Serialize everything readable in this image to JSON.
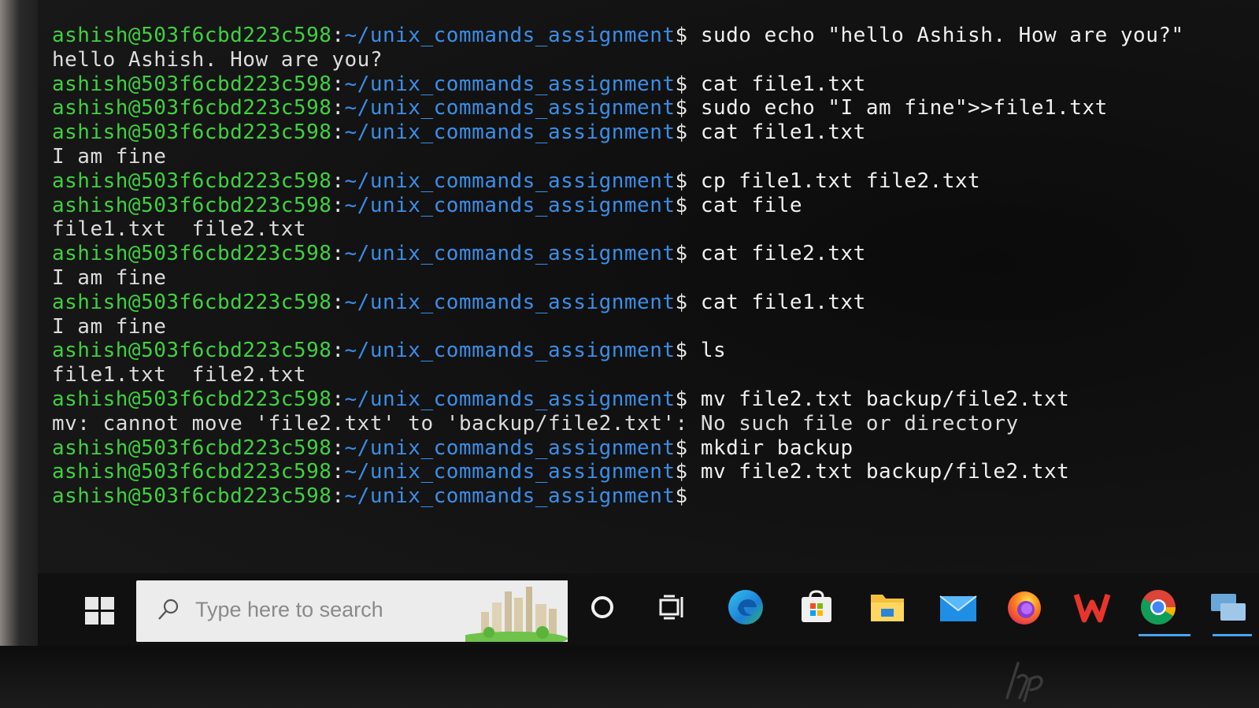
{
  "terminal": {
    "prompt": {
      "user_host": "ashish@503f6cbd223c598",
      "path": "~/unix_commands_assignment",
      "symbol": "$"
    },
    "lines": [
      {
        "type": "prompt",
        "command": " sudo echo \"hello Ashish. How are you?\""
      },
      {
        "type": "output",
        "text": "hello Ashish. How are you?"
      },
      {
        "type": "prompt",
        "command": " cat file1.txt"
      },
      {
        "type": "prompt",
        "command": " sudo echo \"I am fine\">>file1.txt"
      },
      {
        "type": "prompt",
        "command": " cat file1.txt"
      },
      {
        "type": "output",
        "text": "I am fine"
      },
      {
        "type": "prompt",
        "command": " cp file1.txt file2.txt"
      },
      {
        "type": "prompt",
        "command": " cat file"
      },
      {
        "type": "output",
        "text": "file1.txt  file2.txt"
      },
      {
        "type": "prompt",
        "command": " cat file2.txt"
      },
      {
        "type": "output",
        "text": "I am fine"
      },
      {
        "type": "prompt",
        "command": " cat file1.txt"
      },
      {
        "type": "output",
        "text": "I am fine"
      },
      {
        "type": "prompt",
        "command": " ls"
      },
      {
        "type": "output",
        "text": "file1.txt  file2.txt"
      },
      {
        "type": "prompt",
        "command": " mv file2.txt backup/file2.txt"
      },
      {
        "type": "output",
        "text": "mv: cannot move 'file2.txt' to 'backup/file2.txt': No such file or directory"
      },
      {
        "type": "prompt",
        "command": " mkdir backup"
      },
      {
        "type": "prompt",
        "command": " mv file2.txt backup/file2.txt"
      },
      {
        "type": "prompt",
        "command": ""
      }
    ]
  },
  "taskbar": {
    "search_placeholder": "Type here to search",
    "icons": [
      "windows-start-icon",
      "search-icon",
      "cortana-icon",
      "task-view-icon",
      "edge-icon",
      "store-icon",
      "file-explorer-icon",
      "mail-icon",
      "firefox-icon",
      "wps-office-icon",
      "chrome-icon",
      "network-icon"
    ],
    "active_underline": "#4aa3f0"
  },
  "colors": {
    "user_host": "#3fd13f",
    "path": "#3a8ee8",
    "text": "#e6e6e6",
    "background": "#141414"
  }
}
